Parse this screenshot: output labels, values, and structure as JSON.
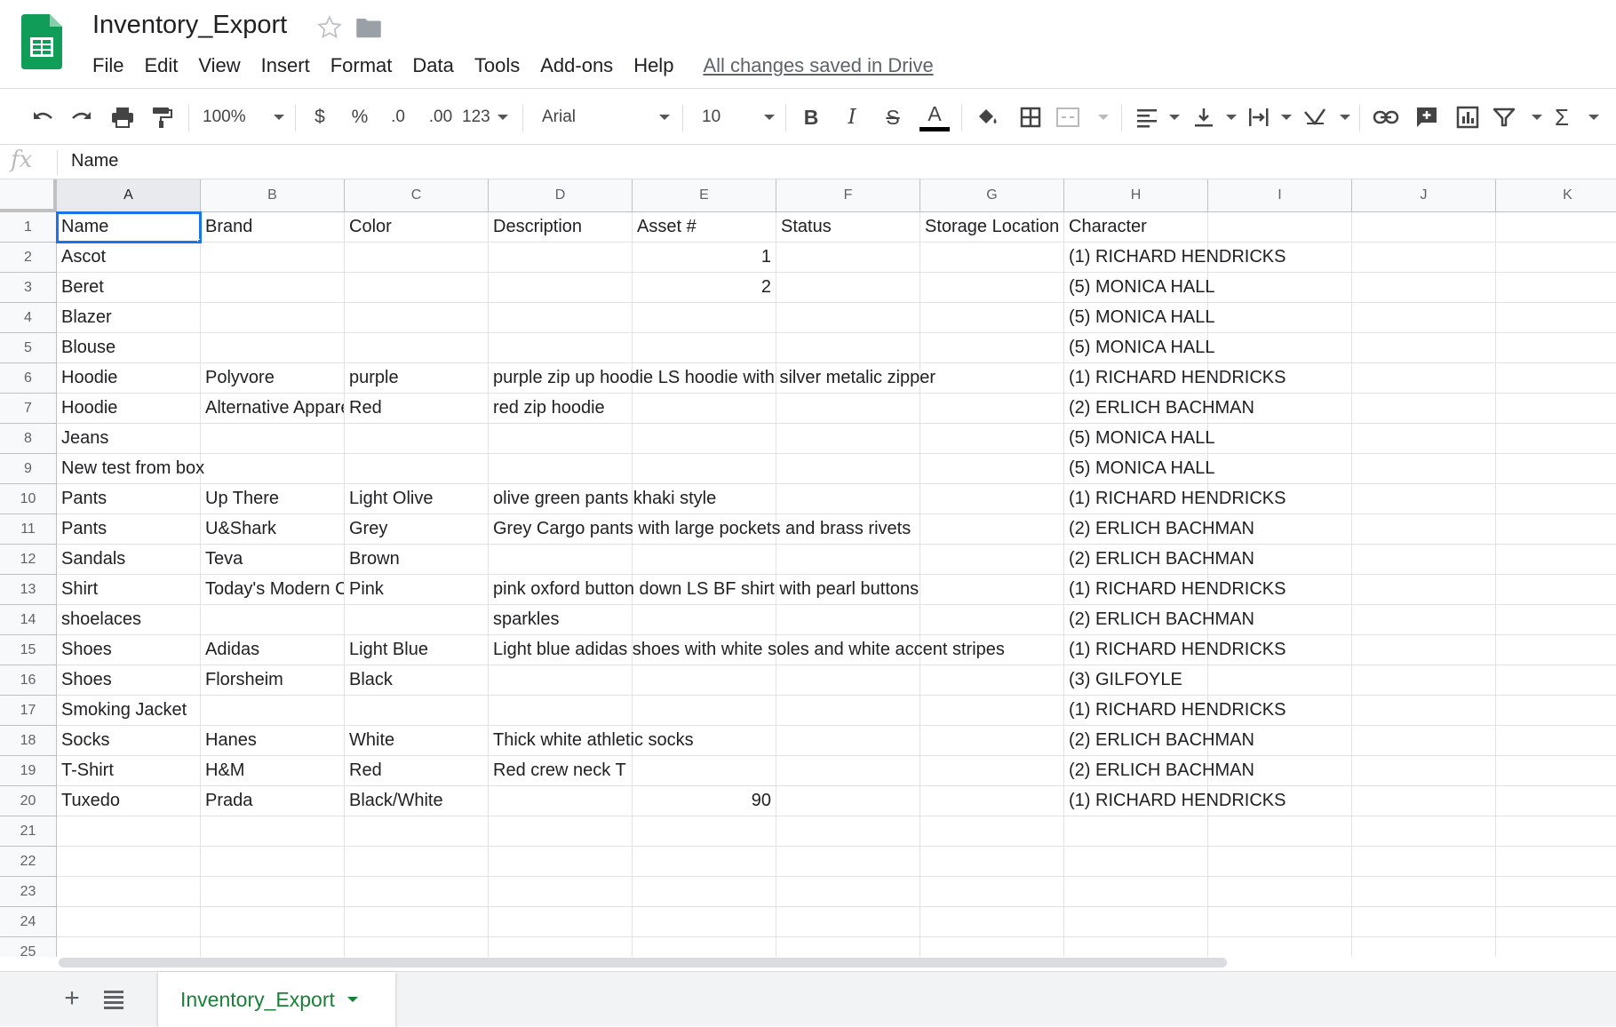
{
  "document": {
    "title": "Inventory_Export",
    "saved_status": "All changes saved in Drive"
  },
  "menu": [
    "File",
    "Edit",
    "View",
    "Insert",
    "Format",
    "Data",
    "Tools",
    "Add-ons",
    "Help"
  ],
  "toolbar": {
    "zoom": "100%",
    "currency": "$",
    "percent": "%",
    "decrease_decimal": ".0",
    "increase_decimal": ".00",
    "more_formats": "123",
    "font_family": "Arial",
    "font_size": "10",
    "bold": "B",
    "italic": "I",
    "strikethrough": "S",
    "text_color_glyph": "A",
    "text_color": "#000000"
  },
  "formula_bar": {
    "fx_glyph": "fx",
    "value": "Name"
  },
  "grid": {
    "columns": [
      "A",
      "B",
      "C",
      "D",
      "E",
      "F",
      "G",
      "H",
      "I",
      "J",
      "K"
    ],
    "row_numbers": [
      "1",
      "2",
      "3",
      "4",
      "5",
      "6",
      "7",
      "8",
      "9",
      "10",
      "11",
      "12",
      "13",
      "14",
      "15",
      "16",
      "17",
      "18",
      "19",
      "20",
      "21",
      "22",
      "23",
      "24",
      "25"
    ],
    "selected_cell": "A1",
    "rows": [
      [
        "Name",
        "Brand",
        "Color",
        "Description",
        "Asset #",
        "Status",
        "Storage Location",
        "Character",
        "",
        "",
        ""
      ],
      [
        "Ascot",
        "",
        "",
        "",
        "1",
        "",
        "",
        "(1) RICHARD HENDRICKS",
        "",
        "",
        ""
      ],
      [
        "Beret",
        "",
        "",
        "",
        "2",
        "",
        "",
        "(5) MONICA HALL",
        "",
        "",
        ""
      ],
      [
        "Blazer",
        "",
        "",
        "",
        "",
        "",
        "",
        "(5) MONICA HALL",
        "",
        "",
        ""
      ],
      [
        "Blouse",
        "",
        "",
        "",
        "",
        "",
        "",
        "(5) MONICA HALL",
        "",
        "",
        ""
      ],
      [
        "Hoodie",
        "Polyvore",
        "purple",
        "purple zip up hoodie LS hoodie with silver metalic zipper",
        "",
        "",
        "",
        "(1) RICHARD HENDRICKS",
        "",
        "",
        ""
      ],
      [
        "Hoodie",
        "Alternative Apparel",
        "Red",
        "red zip hoodie",
        "",
        "",
        "",
        "(2) ERLICH BACHMAN",
        "",
        "",
        ""
      ],
      [
        "Jeans",
        "",
        "",
        "",
        "",
        "",
        "",
        "(5) MONICA HALL",
        "",
        "",
        ""
      ],
      [
        "New test from box",
        "",
        "",
        "",
        "",
        "",
        "",
        "(5) MONICA HALL",
        "",
        "",
        ""
      ],
      [
        "Pants",
        "Up There",
        "Light Olive",
        "olive green pants khaki style",
        "",
        "",
        "",
        "(1) RICHARD HENDRICKS",
        "",
        "",
        ""
      ],
      [
        "Pants",
        "U&Shark",
        "Grey",
        "Grey Cargo pants with large pockets and brass rivets",
        "",
        "",
        "",
        "(2) ERLICH BACHMAN",
        "",
        "",
        ""
      ],
      [
        "Sandals",
        "Teva",
        "Brown",
        "",
        "",
        "",
        "",
        "(2) ERLICH BACHMAN",
        "",
        "",
        ""
      ],
      [
        "Shirt",
        "Today's Modern Classic",
        "Pink",
        "pink oxford button down LS BF shirt with pearl buttons",
        "",
        "",
        "",
        "(1) RICHARD HENDRICKS",
        "",
        "",
        ""
      ],
      [
        "shoelaces",
        "",
        "",
        "sparkles",
        "",
        "",
        "",
        "(2) ERLICH BACHMAN",
        "",
        "",
        ""
      ],
      [
        "Shoes",
        "Adidas",
        "Light Blue",
        "Light blue adidas shoes with white soles and white accent stripes",
        "",
        "",
        "",
        "(1) RICHARD HENDRICKS",
        "",
        "",
        ""
      ],
      [
        "Shoes",
        "Florsheim",
        "Black",
        "",
        "",
        "",
        "",
        "(3) GILFOYLE",
        "",
        "",
        ""
      ],
      [
        "Smoking Jacket",
        "",
        "",
        "",
        "",
        "",
        "",
        "(1) RICHARD HENDRICKS",
        "",
        "",
        ""
      ],
      [
        "Socks",
        "Hanes",
        "White",
        "Thick white athletic socks",
        "",
        "",
        "",
        "(2) ERLICH BACHMAN",
        "",
        "",
        ""
      ],
      [
        "T-Shirt",
        "H&M",
        "Red",
        "Red crew neck T",
        "",
        "",
        "",
        "(2) ERLICH BACHMAN",
        "",
        "",
        ""
      ],
      [
        "Tuxedo",
        "Prada",
        "Black/White",
        "",
        "90",
        "",
        "",
        "(1) RICHARD HENDRICKS",
        "",
        "",
        ""
      ],
      [
        "",
        "",
        "",
        "",
        "",
        "",
        "",
        "",
        "",
        "",
        ""
      ],
      [
        "",
        "",
        "",
        "",
        "",
        "",
        "",
        "",
        "",
        "",
        ""
      ],
      [
        "",
        "",
        "",
        "",
        "",
        "",
        "",
        "",
        "",
        "",
        ""
      ],
      [
        "",
        "",
        "",
        "",
        "",
        "",
        "",
        "",
        "",
        "",
        ""
      ],
      [
        "",
        "",
        "",
        "",
        "",
        "",
        "",
        "",
        "",
        "",
        ""
      ]
    ]
  },
  "sheets": {
    "add_glyph": "+",
    "active_tab": "Inventory_Export"
  },
  "colors": {
    "accent": "#1a73e8",
    "sheets_green": "#188038"
  }
}
